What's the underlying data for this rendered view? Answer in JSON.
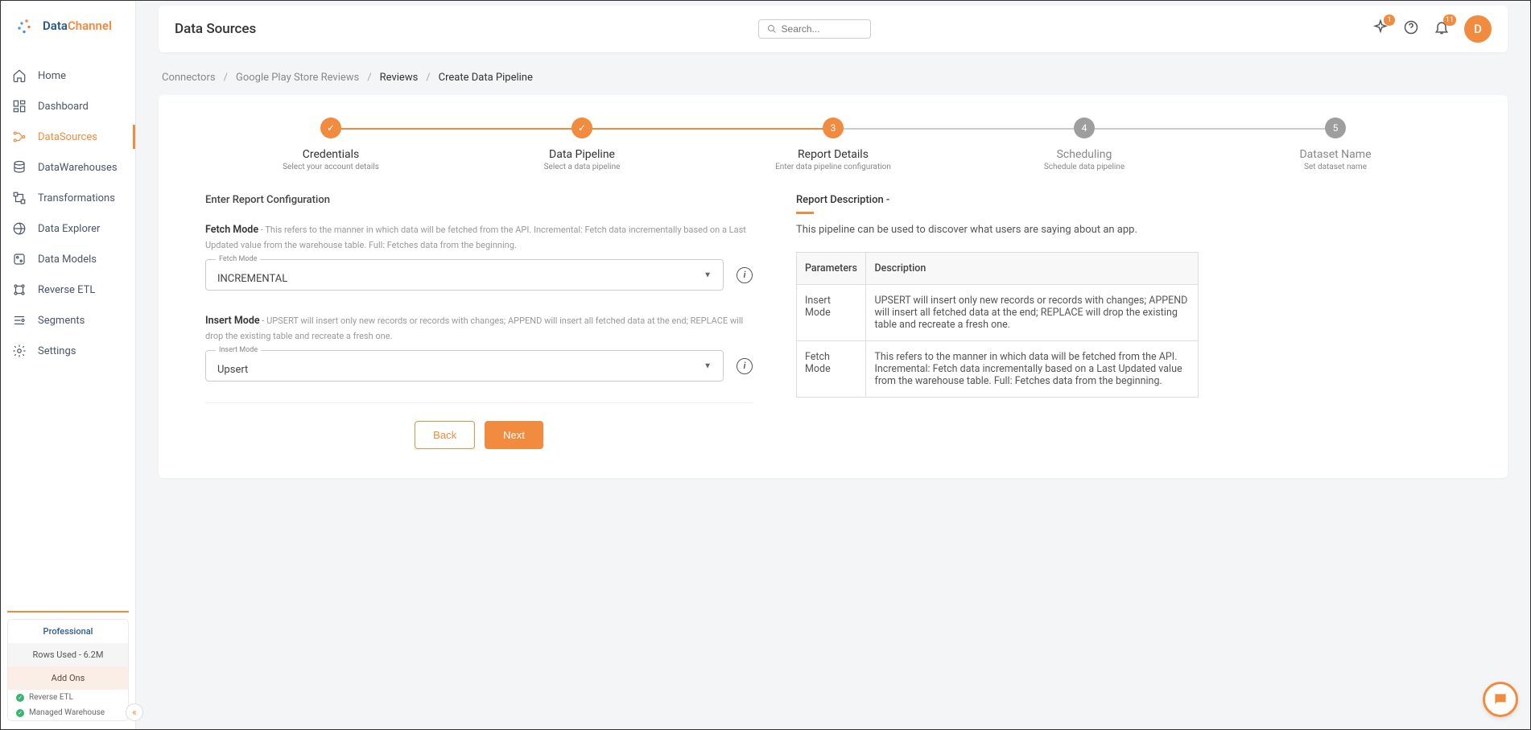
{
  "brand": {
    "part1": "Data",
    "part2": "Channel"
  },
  "sidebar": {
    "items": [
      {
        "label": "Home"
      },
      {
        "label": "Dashboard"
      },
      {
        "label": "DataSources"
      },
      {
        "label": "DataWarehouses"
      },
      {
        "label": "Transformations"
      },
      {
        "label": "Data Explorer"
      },
      {
        "label": "Data Models"
      },
      {
        "label": "Reverse ETL"
      },
      {
        "label": "Segments"
      },
      {
        "label": "Settings"
      }
    ],
    "plan": {
      "name": "Professional",
      "rows": "Rows Used - 6.2M",
      "addons": "Add Ons",
      "feat1": "Reverse ETL",
      "feat2": "Managed Warehouse"
    }
  },
  "topbar": {
    "title": "Data Sources",
    "search_placeholder": "Search...",
    "sparkle_badge": "1",
    "bell_badge": "11",
    "avatar_initial": "D"
  },
  "breadcrumb": {
    "c1": "Connectors",
    "c2": "Google Play Store Reviews",
    "c3": "Reviews",
    "c4": "Create Data Pipeline"
  },
  "steps": [
    {
      "title": "Credentials",
      "sub": "Select your account details",
      "state": "done",
      "mark": "✓"
    },
    {
      "title": "Data Pipeline",
      "sub": "Select a data pipeline",
      "state": "done",
      "mark": "✓"
    },
    {
      "title": "Report Details",
      "sub": "Enter data pipeline configuration",
      "state": "active",
      "mark": "3"
    },
    {
      "title": "Scheduling",
      "sub": "Schedule data pipeline",
      "state": "pending",
      "mark": "4"
    },
    {
      "title": "Dataset Name",
      "sub": "Set dataset name",
      "state": "pending",
      "mark": "5"
    }
  ],
  "form": {
    "section": "Enter Report Configuration",
    "fetch": {
      "label": "Fetch Mode",
      "help": " - This refers to the manner in which data will be fetched from the API. Incremental: Fetch data incrementally based on a Last Updated value from the warehouse table. Full: Fetches data from the beginning.",
      "float": "Fetch Mode",
      "value": "INCREMENTAL"
    },
    "insert": {
      "label": "Insert Mode",
      "help": " - UPSERT will insert only new records or records with changes; APPEND will insert all fetched data at the end; REPLACE will drop the existing table and recreate a fresh one.",
      "float": "Insert Mode",
      "value": "Upsert"
    },
    "back": "Back",
    "next": "Next"
  },
  "desc": {
    "title": "Report Description -",
    "text": "This pipeline can be used to discover what users are saying about an app.",
    "th1": "Parameters",
    "th2": "Description",
    "rows": [
      {
        "p": "Insert Mode",
        "d": "UPSERT will insert only new records or records with changes; APPEND will insert all fetched data at the end; REPLACE will drop the existing table and recreate a fresh one."
      },
      {
        "p": "Fetch Mode",
        "d": "This refers to the manner in which data will be fetched from the API. Incremental: Fetch data incrementally based on a Last Updated value from the warehouse table. Full: Fetches data from the beginning."
      }
    ]
  }
}
